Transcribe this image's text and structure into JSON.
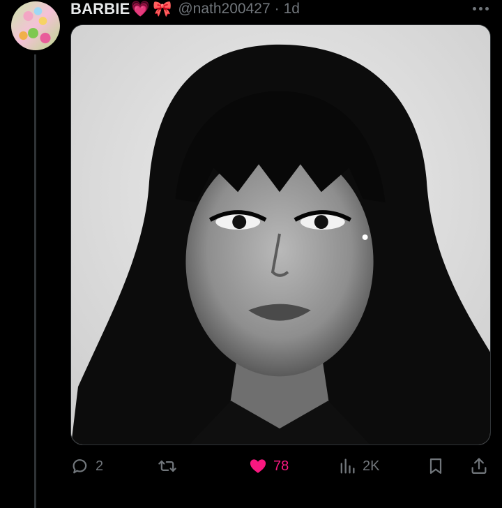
{
  "tweet": {
    "display_name": "BARBIE",
    "name_emoji_1": "💗",
    "name_emoji_2": "🎀",
    "handle": "@nath200427",
    "separator": "·",
    "time": "1d",
    "media_description_icon": "photo-portrait",
    "actions": {
      "reply_count": "2",
      "retweet_count": "",
      "like_count": "78",
      "view_count": "2K"
    },
    "liked": true
  },
  "colors": {
    "background": "#000000",
    "text_primary": "#e7e9ea",
    "text_secondary": "#71767b",
    "like_pink": "#f91880",
    "divider": "#2f3336"
  },
  "icons": {
    "reply": "reply-icon",
    "retweet": "retweet-icon",
    "like": "heart-icon",
    "views": "views-icon",
    "bookmark": "bookmark-icon",
    "share": "share-icon",
    "more": "more-icon"
  }
}
